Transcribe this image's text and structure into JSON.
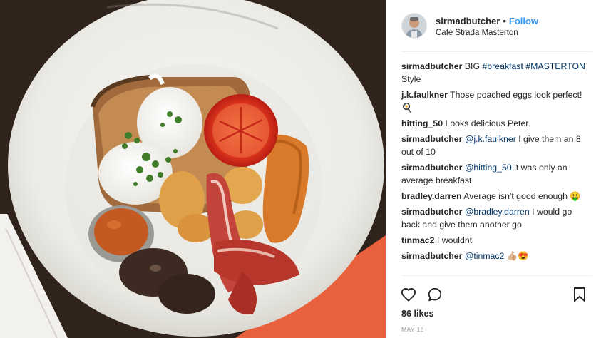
{
  "post": {
    "username": "sirmadbutcher",
    "follow_label": "Follow",
    "location": "Cafe Strada Masterton",
    "likes": "86 likes",
    "date": "MAY 18"
  },
  "comments": [
    {
      "user": "sirmadbutcher",
      "parts": [
        {
          "t": "BIG "
        },
        {
          "t": "#breakfast",
          "link": true
        },
        {
          "t": " "
        },
        {
          "t": "#MASTERTON",
          "link": true
        },
        {
          "t": " Style"
        }
      ]
    },
    {
      "user": "j.k.faulkner",
      "parts": [
        {
          "t": "Those poached eggs look perfect! "
        },
        {
          "t": "🍳"
        }
      ]
    },
    {
      "user": "hitting_50",
      "parts": [
        {
          "t": "Looks delicious Peter."
        }
      ]
    },
    {
      "user": "sirmadbutcher",
      "parts": [
        {
          "t": "@j.k.faulkner",
          "link": true
        },
        {
          "t": " I give them an 8 out of 10"
        }
      ]
    },
    {
      "user": "sirmadbutcher",
      "parts": [
        {
          "t": "@hitting_50",
          "link": true
        },
        {
          "t": " it was only an average breakfast"
        }
      ]
    },
    {
      "user": "bradley.darren",
      "parts": [
        {
          "t": "Average isn't good enough "
        },
        {
          "t": "🤑"
        }
      ]
    },
    {
      "user": "sirmadbutcher",
      "parts": [
        {
          "t": "@bradley.darren",
          "link": true
        },
        {
          "t": " I would go back and give them another go"
        }
      ]
    },
    {
      "user": "tinmac2",
      "parts": [
        {
          "t": "I wouldnt"
        }
      ]
    },
    {
      "user": "sirmadbutcher",
      "parts": [
        {
          "t": "@tinmac2",
          "link": true
        },
        {
          "t": " 👍🏼😍"
        }
      ]
    }
  ],
  "colors": {
    "link_blue": "#3897f0",
    "mention_blue": "#003569",
    "text": "#262626",
    "muted": "#999999",
    "divider": "#efefef"
  },
  "icons": [
    "heart-icon",
    "comment-icon",
    "bookmark-icon"
  ]
}
